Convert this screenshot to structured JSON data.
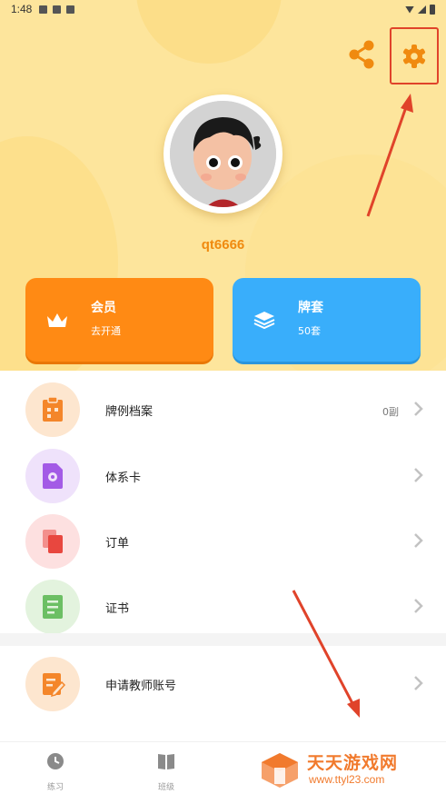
{
  "status_bar": {
    "time": "1:48"
  },
  "profile": {
    "username": "qt6666"
  },
  "cards": {
    "member": {
      "title": "会员",
      "subtitle": "去开通"
    },
    "deck": {
      "title": "牌套",
      "subtitle": "50套"
    }
  },
  "menu": [
    {
      "label": "牌例档案",
      "value": "0副",
      "icon": "clipboard-icon"
    },
    {
      "label": "体系卡",
      "value": "",
      "icon": "document-gear-icon"
    },
    {
      "label": "订单",
      "value": "",
      "icon": "copy-icon"
    },
    {
      "label": "证书",
      "value": "",
      "icon": "certificate-icon"
    },
    {
      "label": "申请教师账号",
      "value": "",
      "icon": "edit-note-icon"
    }
  ],
  "tabbar": {
    "tabs": [
      {
        "label": "练习",
        "icon": "clock-icon"
      },
      {
        "label": "班级",
        "icon": "book-icon"
      }
    ]
  },
  "watermark": {
    "title": "天天游戏网",
    "url": "www.ttyl23.com"
  },
  "colors": {
    "hero_bg": "#fde59c",
    "accent_orange": "#ff8a14",
    "accent_blue": "#39aefb",
    "username": "#f08a0f",
    "annotation_red": "#e0432a"
  }
}
